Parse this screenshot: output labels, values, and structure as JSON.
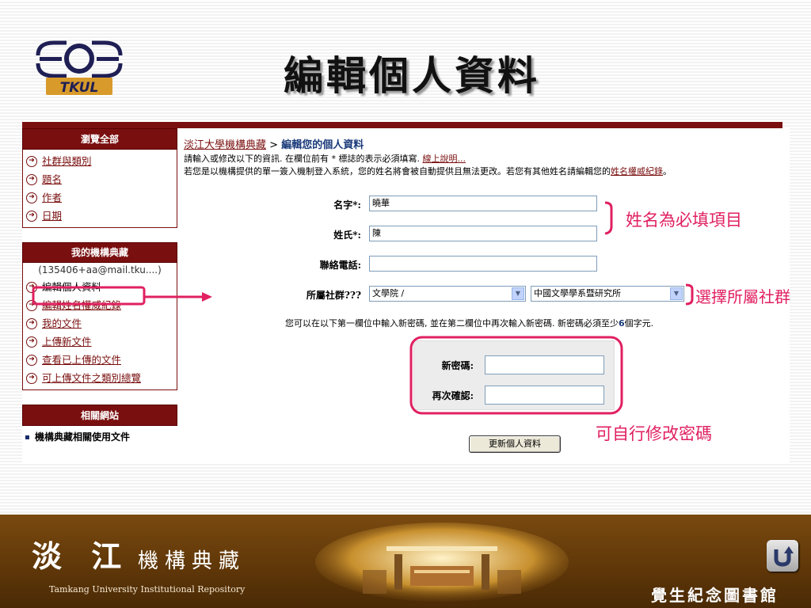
{
  "slide": {
    "title": "編輯個人資料",
    "logo_text": "TKUL"
  },
  "sidebar": {
    "browse_head": "瀏覽全部",
    "browse_items": [
      {
        "label": "社群與類別"
      },
      {
        "label": "題名"
      },
      {
        "label": "作者"
      },
      {
        "label": "日期"
      }
    ],
    "my_head": "我的機構典藏",
    "my_user": "(135406+aa@mail.tku....)",
    "my_items": [
      {
        "label": "編輯個人資料"
      },
      {
        "label": "編輯姓名權威紀錄"
      },
      {
        "label": "我的文件"
      },
      {
        "label": "上傳新文件"
      },
      {
        "label": "查看已上傳的文件"
      },
      {
        "label": "可上傳文件之類別總覽"
      }
    ],
    "related_head": "相關網站",
    "related_items": [
      {
        "label": "機構典藏相關使用文件"
      }
    ]
  },
  "main": {
    "breadcrumb_home": "淡江大學機構典藏",
    "breadcrumb_sep": ">",
    "page_heading": "編輯您的個人資料",
    "intro_line1": "請輸入或修改以下的資訊. 在欄位前有 * 標誌的表示必須填寫.",
    "intro_help_link": "線上說明...",
    "intro_line2": "若您是以機構提供的單一簽入機制登入系統，您的姓名將會被自動提供且無法更改。若您有其他姓名請編輯您的",
    "intro_name_link": "姓名權威紀錄",
    "intro_end": "。",
    "form": {
      "first_name_label": "名字*:",
      "first_name_value": "曉華",
      "last_name_label": "姓氏*:",
      "last_name_value": "陳",
      "phone_label": "聯絡電話:",
      "phone_value": "",
      "community_label": "所屬社群???",
      "community_select1": "文學院 /",
      "community_select2": "中國文學學系暨研究所",
      "password_note_pre": "您可以在以下第一欄位中輸入新密碼, 並在第二欄位中再次輸入新密碼. 新密碼必須至少",
      "password_note_num": "6",
      "password_note_post": "個字元.",
      "new_password_label": "新密碼:",
      "confirm_password_label": "再次確認:",
      "submit_label": "更新個人資料"
    }
  },
  "annotations": {
    "name_required": "姓名為必填項目",
    "select_community": "選擇所屬社群",
    "change_password": "可自行修改密碼"
  },
  "footer": {
    "brand_big": "淡 江",
    "brand_small": "機構典藏",
    "brand_en": "Tamkang University Institutional Repository",
    "library_name": "覺生紀念圖書館"
  },
  "colors": {
    "brand_dark_red": "#7a0f0f",
    "annotation_pink": "#e02060",
    "footer_brown": "#5e3608"
  }
}
